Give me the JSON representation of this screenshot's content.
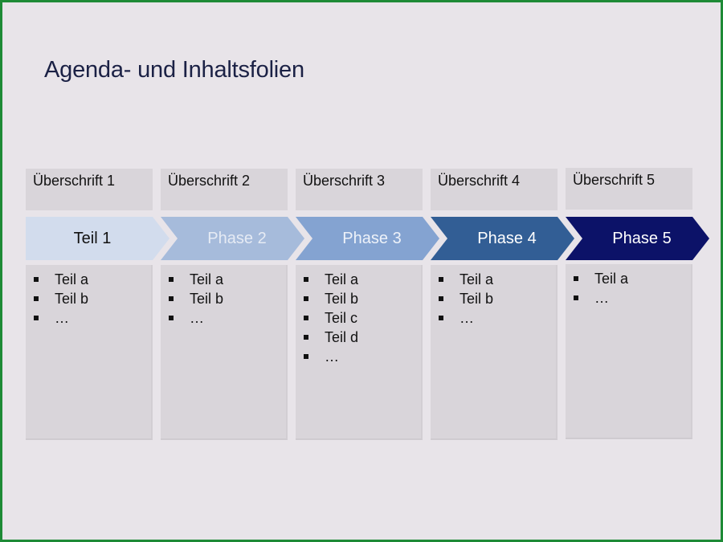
{
  "slide": {
    "title": "Agenda- und Inhaltsfolien",
    "frame_color": "#1e8a36",
    "background_color": "#e8e4e9"
  },
  "columns": [
    {
      "header": "Überschrift 1",
      "phase": "Teil 1",
      "phase_color": "#d2dced",
      "phase_text_color": "#111111",
      "items": [
        "Teil a",
        "Teil b",
        "…"
      ]
    },
    {
      "header": "Überschrift 2",
      "phase": "Phase 2",
      "phase_color": "#a6bbdb",
      "phase_text_color": "#e6ebf4",
      "items": [
        "Teil a",
        "Teil b",
        "…"
      ]
    },
    {
      "header": "Überschrift 3",
      "phase": "Phase 3",
      "phase_color": "#84a3d1",
      "phase_text_color": "#eef2f9",
      "items": [
        "Teil a",
        "Teil b",
        "Teil c",
        "Teil d",
        "…"
      ]
    },
    {
      "header": "Überschrift 4",
      "phase": "Phase 4",
      "phase_color": "#325e95",
      "phase_text_color": "#ffffff",
      "items": [
        "Teil a",
        "Teil b",
        "…"
      ]
    },
    {
      "header": "Überschrift 5",
      "phase": "Phase 5",
      "phase_color": "#0c1268",
      "phase_text_color": "#ffffff",
      "items": [
        "Teil a",
        "…"
      ]
    }
  ]
}
